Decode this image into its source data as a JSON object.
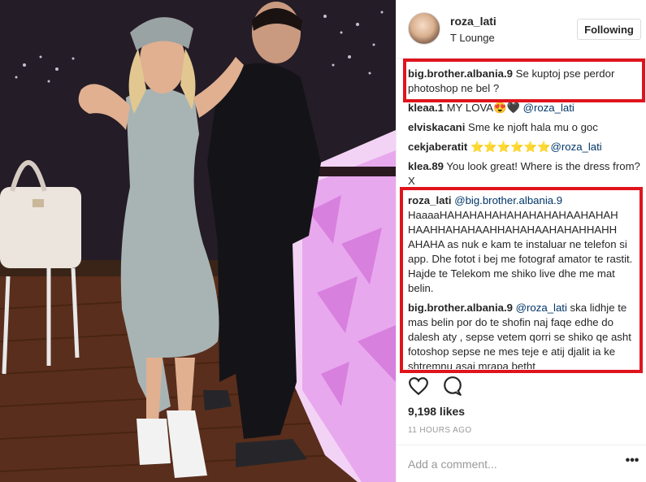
{
  "post": {
    "username": "roza_lati",
    "location": "T Lounge",
    "follow_button": "Following",
    "likes": "9,198 likes",
    "timestamp": "11 HOURS AGO",
    "add_comment_placeholder": "Add a comment...",
    "more_icon": "more-options-icon"
  },
  "comments": [
    {
      "user": "big.brother.albania.9",
      "text": " Se kuptoj pse perdor photoshop ne bel ?",
      "mention": ""
    },
    {
      "user": "kleaa.1",
      "text": " MY LOVA😍🖤 ",
      "mention": "@roza_lati"
    },
    {
      "user": "elviskacani",
      "text": " Sme ke njoft hala mu o goc",
      "mention": ""
    },
    {
      "user": "cekjaberatit",
      "text": " ⭐⭐⭐⭐⭐⭐",
      "mention": "@roza_lati"
    },
    {
      "user": "klea.89",
      "text": " You look great! Where is the dress from? X",
      "mention": ""
    },
    {
      "user": "roza_lati",
      "mention": "@big.brother.albania.9",
      "text": "HaaaaHAHAHAHAHAHAHAHAHAAHAHAH HAAHHAHAHAAHHAHAHAAHAHAHHAHH AHAHA as nuk e kam te instaluar ne telefon si app. Dhe fotot i bej me fotograf amator te rastit. Hajde te Telekom me shiko live dhe me mat belin."
    },
    {
      "user": "big.brother.albania.9",
      "mention": "@roza_lati",
      "text": " ska lidhje te mas belin por do te shofin naj faqe edhe do dalesh aty , sepse vetem qorri se shiko qe asht fotoshop sepse ne mes teje e atij djalit ia ke shtremnu asaj mrapa betht"
    }
  ],
  "colors": {
    "highlight": "#e0141d",
    "mention": "#003569",
    "text": "#262626",
    "muted": "#999999"
  }
}
